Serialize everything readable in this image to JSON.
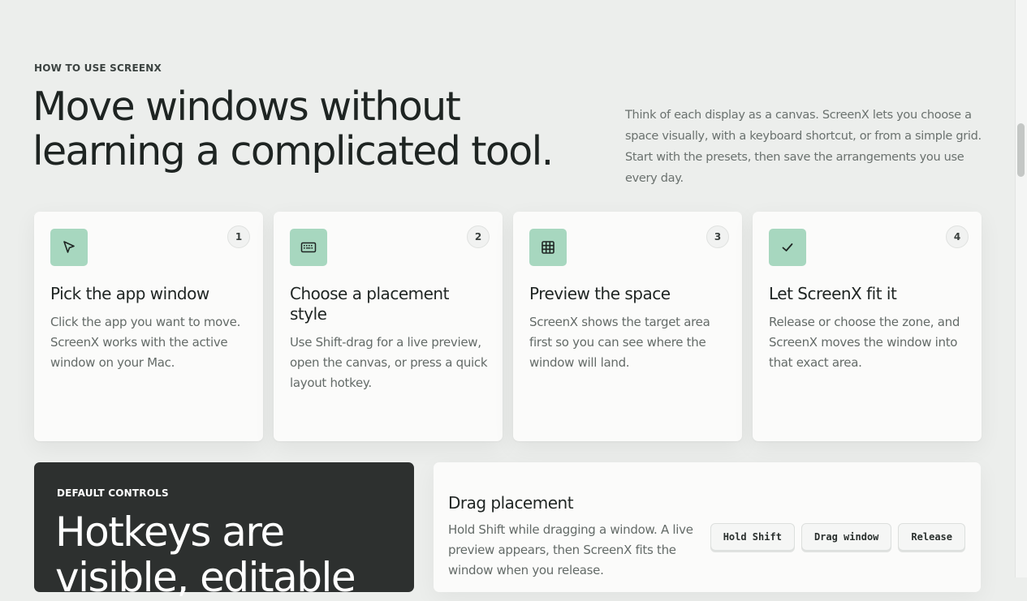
{
  "section": {
    "eyebrow": "HOW TO USE SCREENX",
    "headline_line1": "Move windows without",
    "headline_line2": "learning a complicated tool.",
    "intro": "Think of each display as a canvas. ScreenX lets you choose a space visually, with a keyboard shortcut, or from a simple grid. Start with the presets, then save the arrangements you use every day."
  },
  "steps": [
    {
      "number": "1",
      "icon": "cursor-arrow-icon",
      "title": "Pick the app window",
      "body": "Click the app you want to move. ScreenX works with the active window on your Mac."
    },
    {
      "number": "2",
      "icon": "keyboard-icon",
      "title": "Choose a placement style",
      "body": "Use Shift-drag for a live preview, open the canvas, or press a quick layout hotkey."
    },
    {
      "number": "3",
      "icon": "grid-icon",
      "title": "Preview the space",
      "body": "ScreenX shows the target area first so you can see where the window will land."
    },
    {
      "number": "4",
      "icon": "check-icon",
      "title": "Let ScreenX fit it",
      "body": "Release or choose the zone, and ScreenX moves the window into that exact area."
    }
  ],
  "controls": {
    "eyebrow": "DEFAULT CONTROLS",
    "title": "Hotkeys are visible, editable"
  },
  "drag": {
    "title": "Drag placement",
    "body": "Hold Shift while dragging a window. A live preview appears, then ScreenX fits the window when you release.",
    "keys": [
      "Hold Shift",
      "Drag window",
      "Release"
    ]
  },
  "colors": {
    "accent": "#a7d7bf",
    "background": "#eceeec",
    "dark_panel": "#2d302f"
  }
}
